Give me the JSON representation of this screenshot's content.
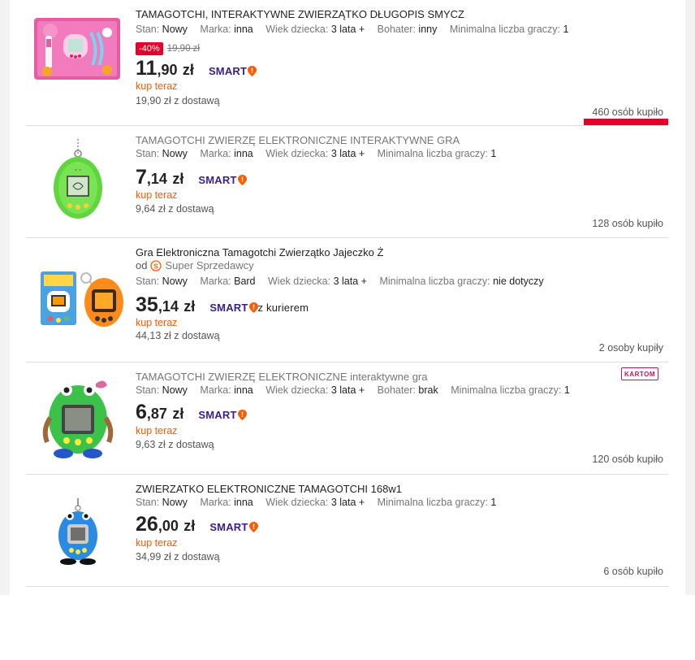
{
  "listing": {
    "items": [
      {
        "title": "TAMAGOTCHI, INTERAKTYWNE ZWIERZĄTKO DŁUGOPIS SMYCZ",
        "params": [
          {
            "label": "Stan:",
            "value": "Nowy"
          },
          {
            "label": "Marka:",
            "value": "inna"
          },
          {
            "label": "Wiek dziecka:",
            "value": "3 lata +"
          },
          {
            "label": "Bohater:",
            "value": "inny"
          },
          {
            "label": "Minimalna liczba graczy:",
            "value": "1"
          }
        ],
        "discount_badge": "-40%",
        "old_price": "19,90 zł",
        "price_int": "11",
        "price_dec": ",90",
        "currency": "zł",
        "smart_label": "SMART",
        "buy_now": "kup teraz",
        "delivery": "19,90 zł z dostawą",
        "bought": "460 osób kupiło"
      },
      {
        "title": "TAMAGOTCHI ZWIERZĘ ELEKTRONICZNE INTERAKTYWNE GRA",
        "params": [
          {
            "label": "Stan:",
            "value": "Nowy"
          },
          {
            "label": "Marka:",
            "value": "inna"
          },
          {
            "label": "Wiek dziecka:",
            "value": "3 lata +"
          },
          {
            "label": "Minimalna liczba graczy:",
            "value": "1"
          }
        ],
        "price_int": "7",
        "price_dec": ",14",
        "currency": "zł",
        "smart_label": "SMART",
        "buy_now": "kup teraz",
        "delivery": "9,64 zł z dostawą",
        "bought": "128 osób kupiło"
      },
      {
        "title": "Gra Elektroniczna Tamagotchi Zwierzątko Jajeczko Ż",
        "seller_prefix": "od",
        "seller": "Super Sprzedawcy",
        "params": [
          {
            "label": "Stan:",
            "value": "Nowy"
          },
          {
            "label": "Marka:",
            "value": "Bard"
          },
          {
            "label": "Wiek dziecka:",
            "value": "3 lata +"
          },
          {
            "label": "Minimalna liczba graczy:",
            "value": "nie dotyczy"
          }
        ],
        "price_int": "35",
        "price_dec": ",14",
        "currency": "zł",
        "smart_label": "SMART",
        "courier": "z kurierem",
        "buy_now": "kup teraz",
        "delivery": "44,13 zł z dostawą",
        "bought": "2 osoby kupiły"
      },
      {
        "title": "TAMAGOTCHI ZWIERZĘ ELEKTRONICZNE interaktywne gra",
        "brand_logo": "KARTOM",
        "params": [
          {
            "label": "Stan:",
            "value": "Nowy"
          },
          {
            "label": "Marka:",
            "value": "inna"
          },
          {
            "label": "Wiek dziecka:",
            "value": "3 lata +"
          },
          {
            "label": "Bohater:",
            "value": "brak"
          },
          {
            "label": "Minimalna liczba graczy:",
            "value": "1"
          }
        ],
        "price_int": "6",
        "price_dec": ",87",
        "currency": "zł",
        "smart_label": "SMART",
        "buy_now": "kup teraz",
        "delivery": "9,63 zł z dostawą",
        "bought": "120 osób kupiło"
      },
      {
        "title": "ZWIERZATKO ELEKTRONICZNE TAMAGOTCHI 168w1",
        "params": [
          {
            "label": "Stan:",
            "value": "Nowy"
          },
          {
            "label": "Marka:",
            "value": "inna"
          },
          {
            "label": "Wiek dziecka:",
            "value": "3 lata +"
          },
          {
            "label": "Minimalna liczba graczy:",
            "value": "1"
          }
        ],
        "price_int": "26",
        "price_dec": ",00",
        "currency": "zł",
        "smart_label": "SMART",
        "buy_now": "kup teraz",
        "delivery": "34,99 zł z dostawą",
        "bought": "6 osób kupiło"
      }
    ]
  },
  "colors": {
    "accent_orange": "#ff5a00",
    "smart_purple": "#3b1e88",
    "discount_red": "#e4002b"
  }
}
